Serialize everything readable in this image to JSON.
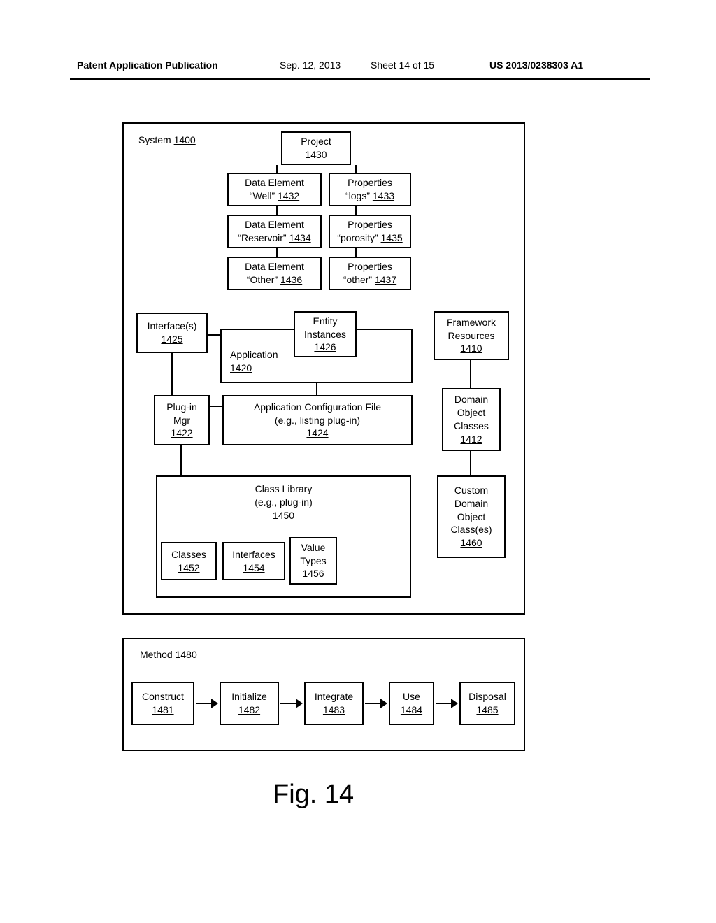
{
  "header": {
    "left": "Patent Application Publication",
    "date": "Sep. 12, 2013",
    "sheet": "Sheet 14 of 15",
    "pubno": "US 2013/0238303 A1"
  },
  "figure": {
    "caption": "Fig. 14"
  },
  "system": {
    "title": "System",
    "title_ref": "1400",
    "project": {
      "label": "Project",
      "ref": "1430"
    },
    "data_element_well": {
      "l1": "Data Element",
      "l2": "“Well”",
      "ref": "1432"
    },
    "properties_logs": {
      "l1": "Properties",
      "l2": "“logs”",
      "ref": "1433"
    },
    "data_element_res": {
      "l1": "Data Element",
      "l2": "“Reservoir”",
      "ref": "1434"
    },
    "properties_porosity": {
      "l1": "Properties",
      "l2": "“porosity”",
      "ref": "1435"
    },
    "data_element_other": {
      "l1": "Data Element",
      "l2": "“Other”",
      "ref": "1436"
    },
    "properties_other": {
      "l1": "Properties",
      "l2": "“other”",
      "ref": "1437"
    },
    "interfaces": {
      "label": "Interface(s)",
      "ref": "1425"
    },
    "entity_instances": {
      "l1": "Entity",
      "l2": "Instances",
      "ref": "1426"
    },
    "framework_res": {
      "l1": "Framework",
      "l2": "Resources",
      "ref": "1410"
    },
    "application": {
      "label": "Application",
      "ref": "1420"
    },
    "plugin_mgr": {
      "l1": "Plug-in",
      "l2": "Mgr",
      "ref": "1422"
    },
    "app_cfg": {
      "l1": "Application Configuration File",
      "l2": "(e.g., listing plug-in)",
      "ref": "1424"
    },
    "domain_obj": {
      "l1": "Domain",
      "l2": "Object",
      "l3": "Classes",
      "ref": "1412"
    },
    "class_library": {
      "l1": "Class Library",
      "l2": "(e.g., plug-in)",
      "ref": "1450"
    },
    "classes": {
      "label": "Classes",
      "ref": "1452"
    },
    "lib_interfaces": {
      "label": "Interfaces",
      "ref": "1454"
    },
    "value_types": {
      "l1": "Value",
      "l2": "Types",
      "ref": "1456"
    },
    "custom_domain": {
      "l1": "Custom",
      "l2": "Domain",
      "l3": "Object",
      "l4": "Class(es)",
      "ref": "1460"
    }
  },
  "method": {
    "title": "Method",
    "title_ref": "1480",
    "steps": [
      {
        "label": "Construct",
        "ref": "1481"
      },
      {
        "label": "Initialize",
        "ref": "1482"
      },
      {
        "label": "Integrate",
        "ref": "1483"
      },
      {
        "label": "Use",
        "ref": "1484"
      },
      {
        "label": "Disposal",
        "ref": "1485"
      }
    ]
  }
}
